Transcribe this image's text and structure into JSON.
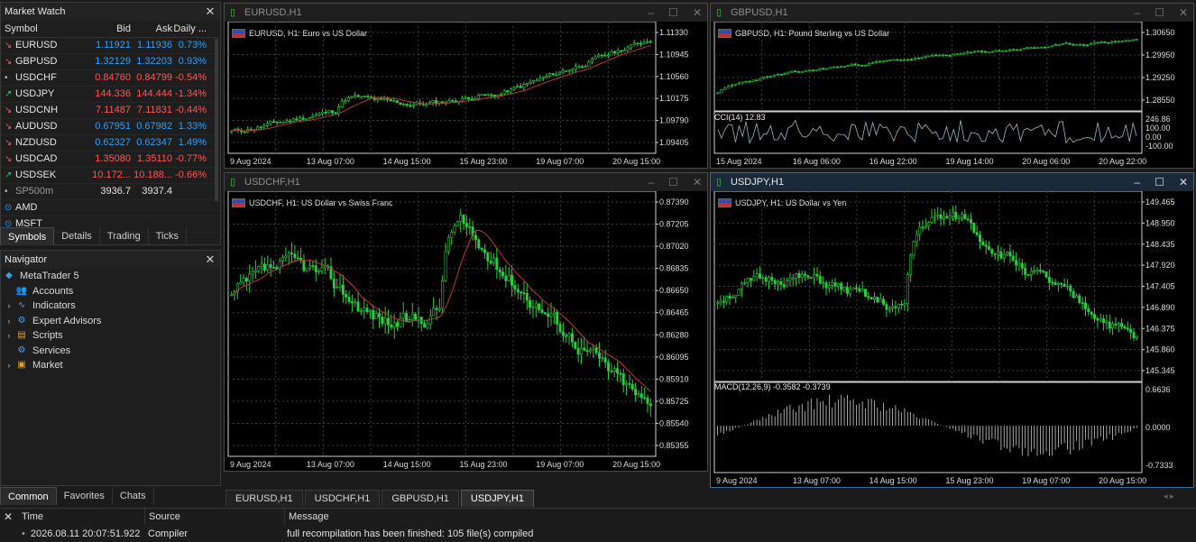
{
  "market_watch": {
    "title": "Market Watch",
    "headers": [
      "Symbol",
      "Bid",
      "Ask",
      "Daily ..."
    ],
    "rows": [
      {
        "symbol": "EURUSD",
        "bid": "1.11921",
        "ask": "1.11936",
        "daily": "0.73%",
        "dir": "down",
        "color": "#2fa0ff"
      },
      {
        "symbol": "GBPUSD",
        "bid": "1.32129",
        "ask": "1.32203",
        "daily": "0.93%",
        "dir": "down",
        "color": "#2fa0ff"
      },
      {
        "symbol": "USDCHF",
        "bid": "0.84760",
        "ask": "0.84799",
        "daily": "-0.54%",
        "dir": "dot",
        "color": "#ff5858"
      },
      {
        "symbol": "USDJPY",
        "bid": "144.336",
        "ask": "144.444",
        "daily": "-1.34%",
        "dir": "up",
        "color": "#ff5858"
      },
      {
        "symbol": "USDCNH",
        "bid": "7.11487",
        "ask": "7.11831",
        "daily": "-0.44%",
        "dir": "down",
        "color": "#ff5858"
      },
      {
        "symbol": "AUDUSD",
        "bid": "0.67951",
        "ask": "0.67982",
        "daily": "1.33%",
        "dir": "down",
        "color": "#2fa0ff"
      },
      {
        "symbol": "NZDUSD",
        "bid": "0.62327",
        "ask": "0.62347",
        "daily": "1.49%",
        "dir": "down",
        "color": "#2fa0ff"
      },
      {
        "symbol": "USDCAD",
        "bid": "1.35080",
        "ask": "1.35110",
        "daily": "-0.77%",
        "dir": "down",
        "color": "#ff5858"
      },
      {
        "symbol": "USDSEK",
        "bid": "10.172...",
        "ask": "10.188...",
        "daily": "-0.66%",
        "dir": "up",
        "color": "#ff5858"
      },
      {
        "symbol": "SP500m",
        "bid": "3936.7",
        "ask": "3937.4",
        "daily": "",
        "dir": "dot",
        "color": "#bbbbbb"
      },
      {
        "symbol": "AMD",
        "bid": "",
        "ask": "",
        "daily": "",
        "dir": "circle",
        "color": "#bbbbbb"
      },
      {
        "symbol": "MSFT",
        "bid": "",
        "ask": "",
        "daily": "",
        "dir": "circle",
        "color": "#bbbbbb"
      }
    ],
    "tabs": [
      "Symbols",
      "Details",
      "Trading",
      "Ticks"
    ]
  },
  "navigator": {
    "title": "Navigator",
    "root": "MetaTrader 5",
    "items": [
      {
        "label": "Accounts",
        "icon": "accounts-icon",
        "caret": ""
      },
      {
        "label": "Indicators",
        "icon": "indicators-icon",
        "caret": "›"
      },
      {
        "label": "Expert Advisors",
        "icon": "expert-advisors-icon",
        "caret": "›"
      },
      {
        "label": "Scripts",
        "icon": "scripts-icon",
        "caret": "›"
      },
      {
        "label": "Services",
        "icon": "services-icon",
        "caret": ""
      },
      {
        "label": "Market",
        "icon": "market-icon",
        "caret": "›"
      }
    ],
    "tabs": [
      "Common",
      "Favorites",
      "Chats"
    ]
  },
  "charts": [
    {
      "id": "eurusd",
      "title": "EURUSD,H1",
      "legend": "EURUSD, H1:  Euro vs US Dollar",
      "prices": [
        "1.11330",
        "1.10945",
        "1.10560",
        "1.10175",
        "1.09790",
        "1.09405"
      ],
      "dates": [
        "9 Aug 2024",
        "13 Aug 07:00",
        "14 Aug 15:00",
        "15 Aug 23:00",
        "19 Aug 07:00",
        "20 Aug 15:00"
      ]
    },
    {
      "id": "gbpusd",
      "title": "GBPUSD,H1",
      "legend": "GBPUSD, H1:  Pound Sterling vs US Dollar",
      "prices": [
        "1.30650",
        "1.29950",
        "1.29250",
        "1.28550"
      ],
      "indicator": "CCI(14) 12.83",
      "ind_levels": [
        "246.86",
        "100.00",
        "0.00",
        "-100.00"
      ],
      "dates": [
        "15 Aug 2024",
        "16 Aug 06:00",
        "16 Aug 22:00",
        "19 Aug 14:00",
        "20 Aug 06:00",
        "20 Aug 22:00"
      ]
    },
    {
      "id": "usdchf",
      "title": "USDCHF,H1",
      "legend": "USDCHF, H1:  US Dollar vs Swiss Franc",
      "prices": [
        "0.87390",
        "0.87205",
        "0.87020",
        "0.86835",
        "0.86650",
        "0.86465",
        "0.86280",
        "0.86095",
        "0.85910",
        "0.85725",
        "0.85540",
        "0.85355"
      ],
      "dates": [
        "9 Aug 2024",
        "13 Aug 07:00",
        "14 Aug 15:00",
        "15 Aug 23:00",
        "19 Aug 07:00",
        "20 Aug 15:00"
      ]
    },
    {
      "id": "usdjpy",
      "title": "USDJPY,H1",
      "legend": "USDJPY, H1:  US Dollar vs Yen",
      "prices": [
        "149.465",
        "148.950",
        "148.435",
        "147.920",
        "147.405",
        "146.890",
        "146.375",
        "145.860",
        "145.345"
      ],
      "indicator": "MACD(12,26,9) -0.3582 -0.3739",
      "ind_levels": [
        "0.6636",
        "0.0000",
        "-0.7333"
      ],
      "dates": [
        "9 Aug 2024",
        "13 Aug 07:00",
        "14 Aug 15:00",
        "15 Aug 23:00",
        "19 Aug 07:00",
        "20 Aug 15:00"
      ]
    }
  ],
  "chart_tabs": [
    "EURUSD,H1",
    "USDCHF,H1",
    "GBPUSD,H1",
    "USDJPY,H1"
  ],
  "toolbox": {
    "headers": [
      "Time",
      "Source",
      "Message"
    ],
    "row": {
      "time": "2026.08.11 20:07:51.922",
      "source": "Compiler",
      "message": "full recompilation has been finished: 105 file(s) compiled"
    }
  },
  "colors": {
    "up": "#2fa0ff",
    "down": "#ff5858",
    "candle": "#2ecc40",
    "ma": "#c0392b",
    "grid": "#3a3a3a",
    "active_border": "#3d6e9e"
  }
}
